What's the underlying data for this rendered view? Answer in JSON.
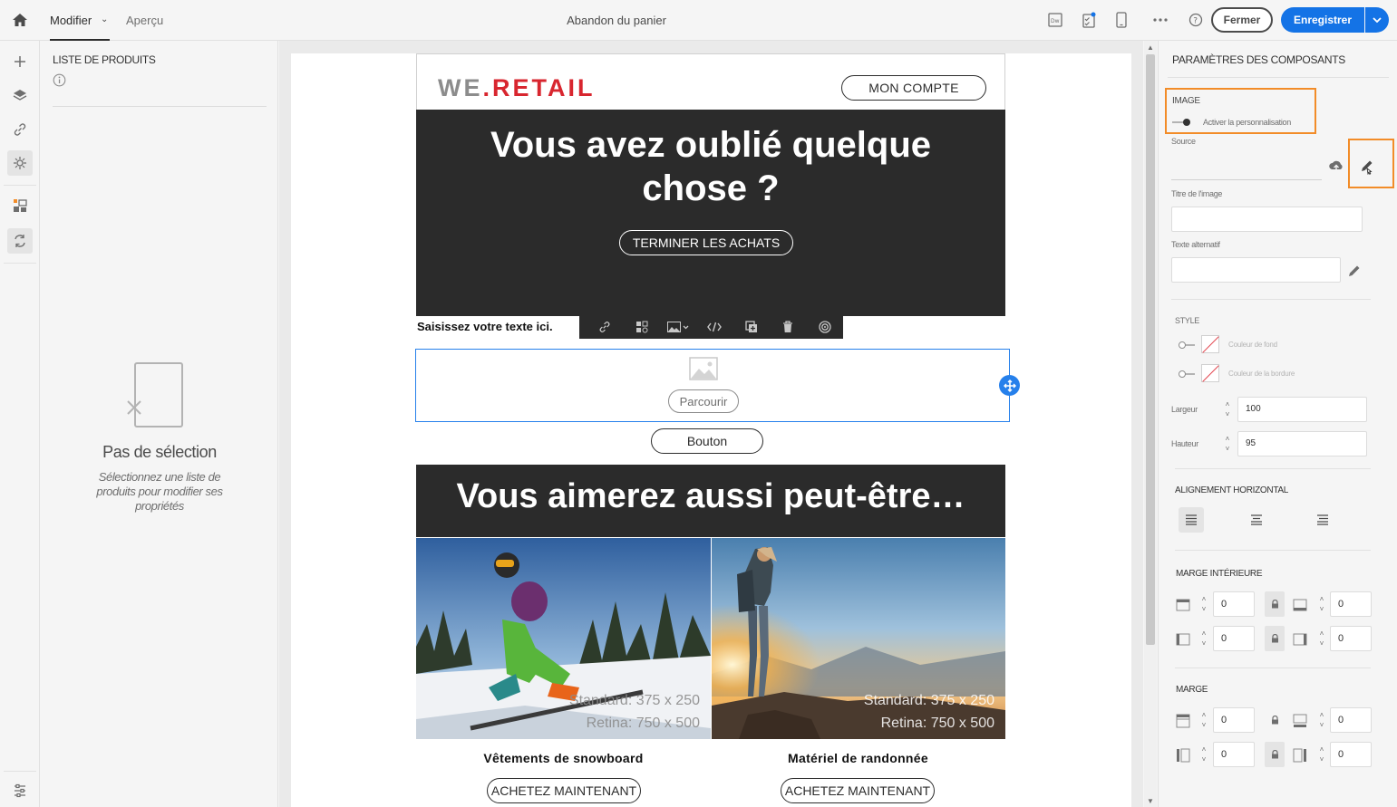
{
  "header": {
    "tab_modify": "Modifier",
    "tab_preview": "Aperçu",
    "doc_title": "Abandon du panier",
    "close_label": "Fermer",
    "save_label": "Enregistrer"
  },
  "left_panel": {
    "title": "LISTE DE PRODUITS",
    "empty_title": "Pas de sélection",
    "empty_desc": "Sélectionnez une liste de produits pour modifier ses propriétés"
  },
  "email": {
    "logo_we": "WE",
    "logo_dot": ".",
    "logo_retail": "RETAIL",
    "account_button": "MON COMPTE",
    "hero_title": "Vous avez oublié quelque chose ?",
    "finish_button": "TERMINER LES ACHATS",
    "text_placeholder": "Saisissez votre texte ici.",
    "browse_button": "Parcourir",
    "generic_button": "Bouton",
    "band_title": "Vous aimerez aussi peut-être…",
    "products": [
      {
        "name": "Vêtements de snowboard",
        "dims1": "Standard: 375 x 250",
        "dims2": "Retina: 750 x 500",
        "cta": "ACHETEZ MAINTENANT"
      },
      {
        "name": "Matériel de randonnée",
        "dims1": "Standard: 375 x 250",
        "dims2": "Retina: 750 x 500",
        "cta": "ACHETEZ MAINTENANT"
      }
    ]
  },
  "right_panel": {
    "title": "PARAMÈTRES DES COMPOSANTS",
    "image_section": "IMAGE",
    "personalize_label": "Activer la personnalisation",
    "source_label": "Source",
    "image_title_label": "Titre de l'image",
    "alt_text_label": "Texte alternatif",
    "style_section": "STYLE",
    "bg_color_label": "Couleur de fond",
    "border_color_label": "Couleur de la bordure",
    "width_label": "Largeur",
    "width_value": "100",
    "height_label": "Hauteur",
    "height_value": "95",
    "align_section": "ALIGNEMENT HORIZONTAL",
    "padding_section": "MARGE INTÉRIEURE",
    "margin_section": "MARGE",
    "padding_values": [
      "0",
      "0",
      "0",
      "0"
    ],
    "margin_values": [
      "0",
      "0",
      "0",
      "0"
    ]
  },
  "colors": {
    "accent": "#1473e6",
    "highlight": "#f28c28",
    "logo_red": "#d8262f",
    "hero_bg": "#2b2b2b"
  }
}
